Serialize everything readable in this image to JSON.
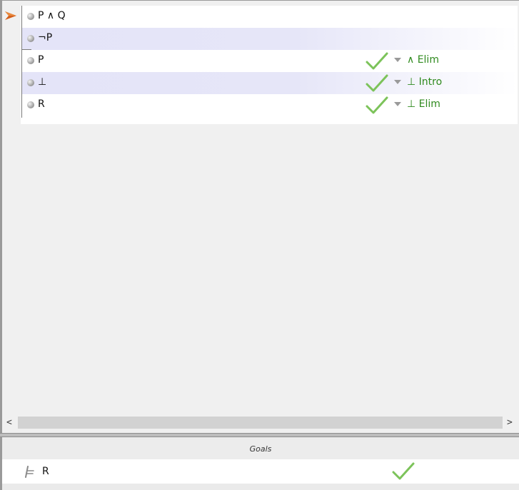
{
  "proof": {
    "lines": [
      {
        "formula": "P ∧ Q",
        "rule": "",
        "status": ""
      },
      {
        "formula": "¬P",
        "rule": "",
        "status": ""
      },
      {
        "formula": "P",
        "rule": "∧ Elim",
        "status": "valid"
      },
      {
        "formula": "⊥",
        "rule": "⊥ Intro",
        "status": "valid"
      },
      {
        "formula": "R",
        "rule": "⊥ Elim",
        "status": "valid"
      }
    ]
  },
  "scrollbar": {
    "left_arrow": "<",
    "right_arrow": ">"
  },
  "goals": {
    "header": "Goals",
    "items": [
      {
        "formula": "R",
        "status": "valid"
      }
    ]
  },
  "colors": {
    "check_green": "#7cc35a",
    "rule_text": "#2f8a1e",
    "cursor_arrow": "#d4601c",
    "alt_row": "#e4e4f8"
  }
}
